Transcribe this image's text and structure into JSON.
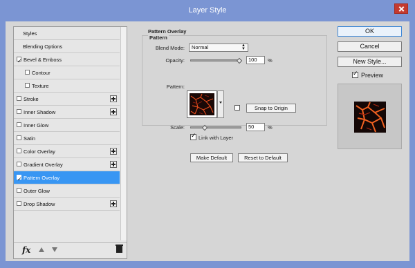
{
  "window": {
    "title": "Layer Style",
    "close_icon": "close-icon"
  },
  "left_panel": {
    "items": [
      {
        "label": "Styles",
        "checkbox": false,
        "checked": false,
        "plus": false,
        "selected": false
      },
      {
        "label": "Blending Options",
        "checkbox": false,
        "checked": false,
        "plus": false,
        "selected": false
      },
      {
        "label": "Bevel & Emboss",
        "checkbox": true,
        "checked": true,
        "plus": false,
        "selected": false
      },
      {
        "label": "Contour",
        "checkbox": true,
        "checked": false,
        "plus": false,
        "selected": false,
        "indent": true
      },
      {
        "label": "Texture",
        "checkbox": true,
        "checked": false,
        "plus": false,
        "selected": false,
        "indent": true
      },
      {
        "label": "Stroke",
        "checkbox": true,
        "checked": false,
        "plus": true,
        "selected": false
      },
      {
        "label": "Inner Shadow",
        "checkbox": true,
        "checked": false,
        "plus": true,
        "selected": false
      },
      {
        "label": "Inner Glow",
        "checkbox": true,
        "checked": false,
        "plus": false,
        "selected": false
      },
      {
        "label": "Satin",
        "checkbox": true,
        "checked": false,
        "plus": false,
        "selected": false
      },
      {
        "label": "Color Overlay",
        "checkbox": true,
        "checked": false,
        "plus": true,
        "selected": false
      },
      {
        "label": "Gradient Overlay",
        "checkbox": true,
        "checked": false,
        "plus": true,
        "selected": false
      },
      {
        "label": "Pattern Overlay",
        "checkbox": true,
        "checked": true,
        "plus": false,
        "selected": true
      },
      {
        "label": "Outer Glow",
        "checkbox": true,
        "checked": false,
        "plus": false,
        "selected": false
      },
      {
        "label": "Drop Shadow",
        "checkbox": true,
        "checked": false,
        "plus": true,
        "selected": false
      }
    ],
    "footer": {
      "fx_label": "fx",
      "up_icon": "arrow-up-icon",
      "down_icon": "arrow-down-icon",
      "trash_icon": "trash-icon"
    }
  },
  "middle_panel": {
    "section_title": "Pattern Overlay",
    "group_title": "Pattern",
    "blend_mode": {
      "label": "Blend Mode:",
      "value": "Normal"
    },
    "opacity": {
      "label": "Opacity:",
      "value": "100",
      "unit": "%"
    },
    "pattern": {
      "label": "Pattern:",
      "snap_button": "Snap to Origin"
    },
    "scale": {
      "label": "Scale:",
      "value": "50",
      "unit": "%"
    },
    "link_with_layer": {
      "label": "Link with Layer",
      "checked": true
    },
    "make_default": "Make Default",
    "reset_default": "Reset to Default"
  },
  "right_panel": {
    "ok": "OK",
    "cancel": "Cancel",
    "new_style": "New Style...",
    "preview": {
      "label": "Preview",
      "checked": true
    }
  },
  "colors": {
    "title_bar": "#7b95d3",
    "selection": "#3896f3",
    "close_button": "#c43a2f"
  }
}
